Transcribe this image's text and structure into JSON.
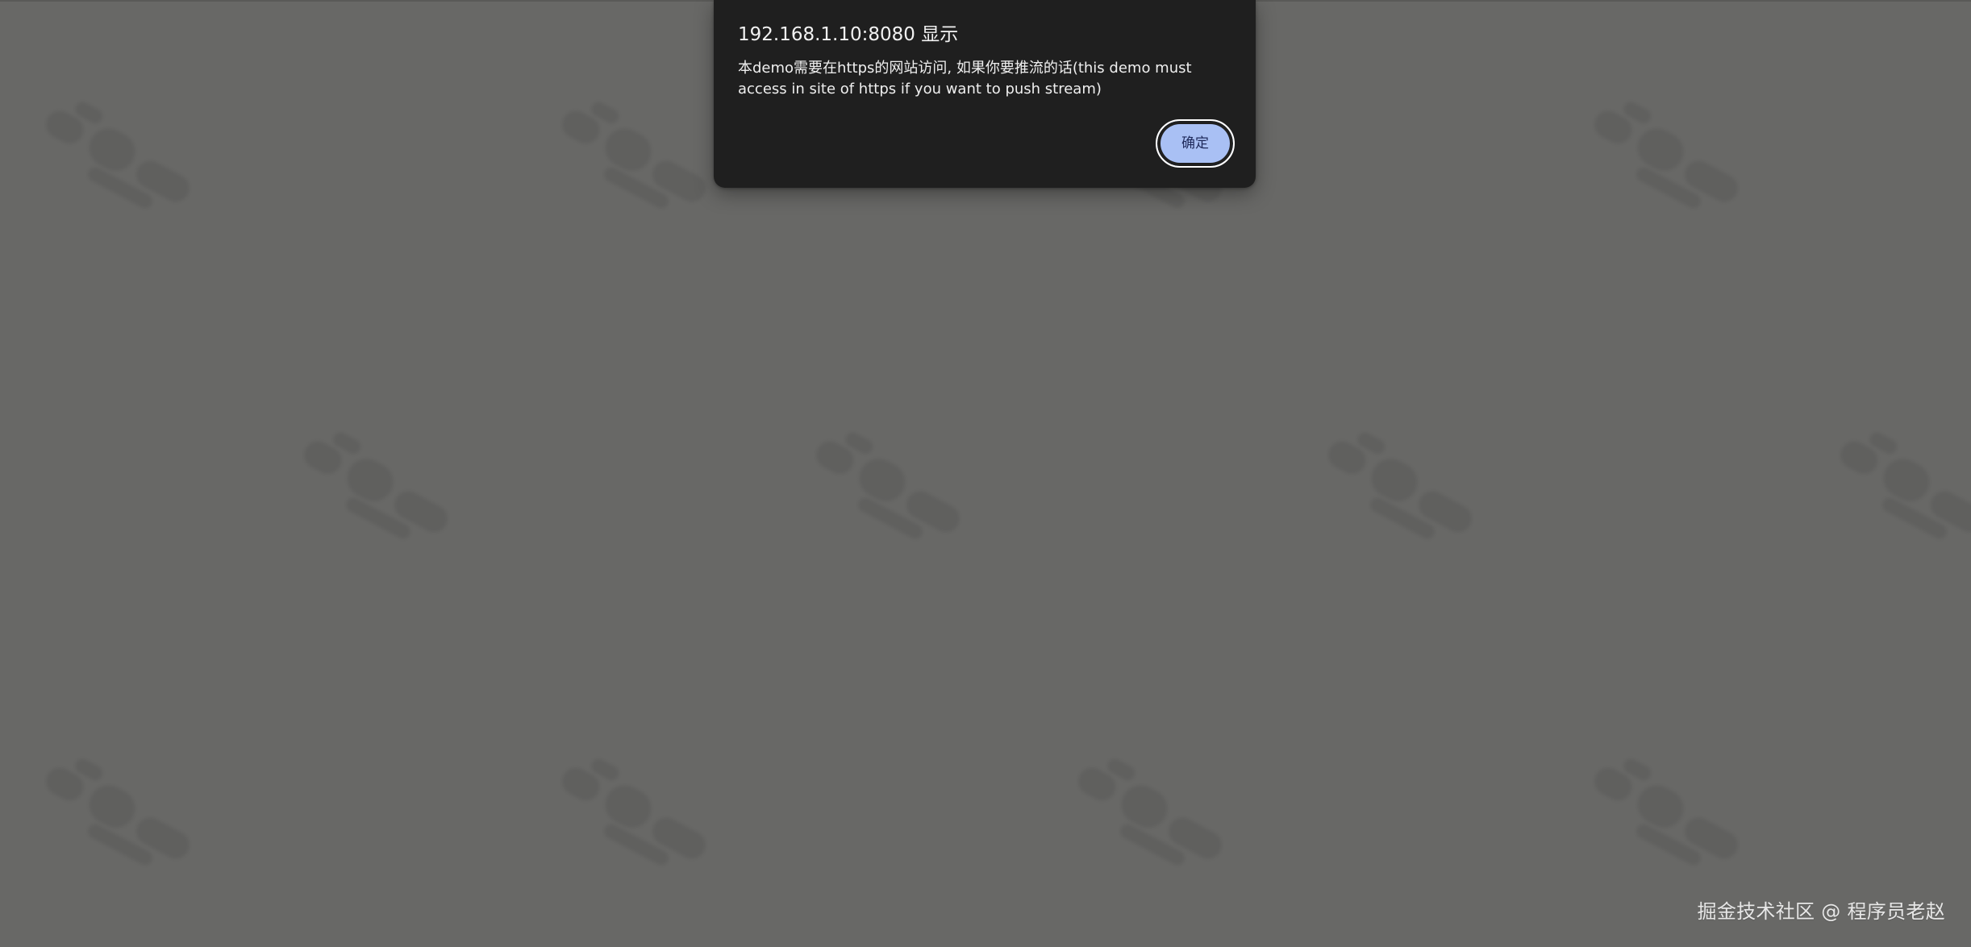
{
  "page": {
    "background_color": "#686866",
    "accent_color": "#a9c0f4"
  },
  "alert": {
    "title": "192.168.1.10:8080 显示",
    "message_line_1": "本demo需要在https的网站访问, 如果你要推流的话(this demo must",
    "message_line_2": "access in site of https if you want to push stream)",
    "confirm_label": "确定"
  },
  "footer": {
    "attribution": "掘金技术社区 @ 程序员老赵"
  }
}
